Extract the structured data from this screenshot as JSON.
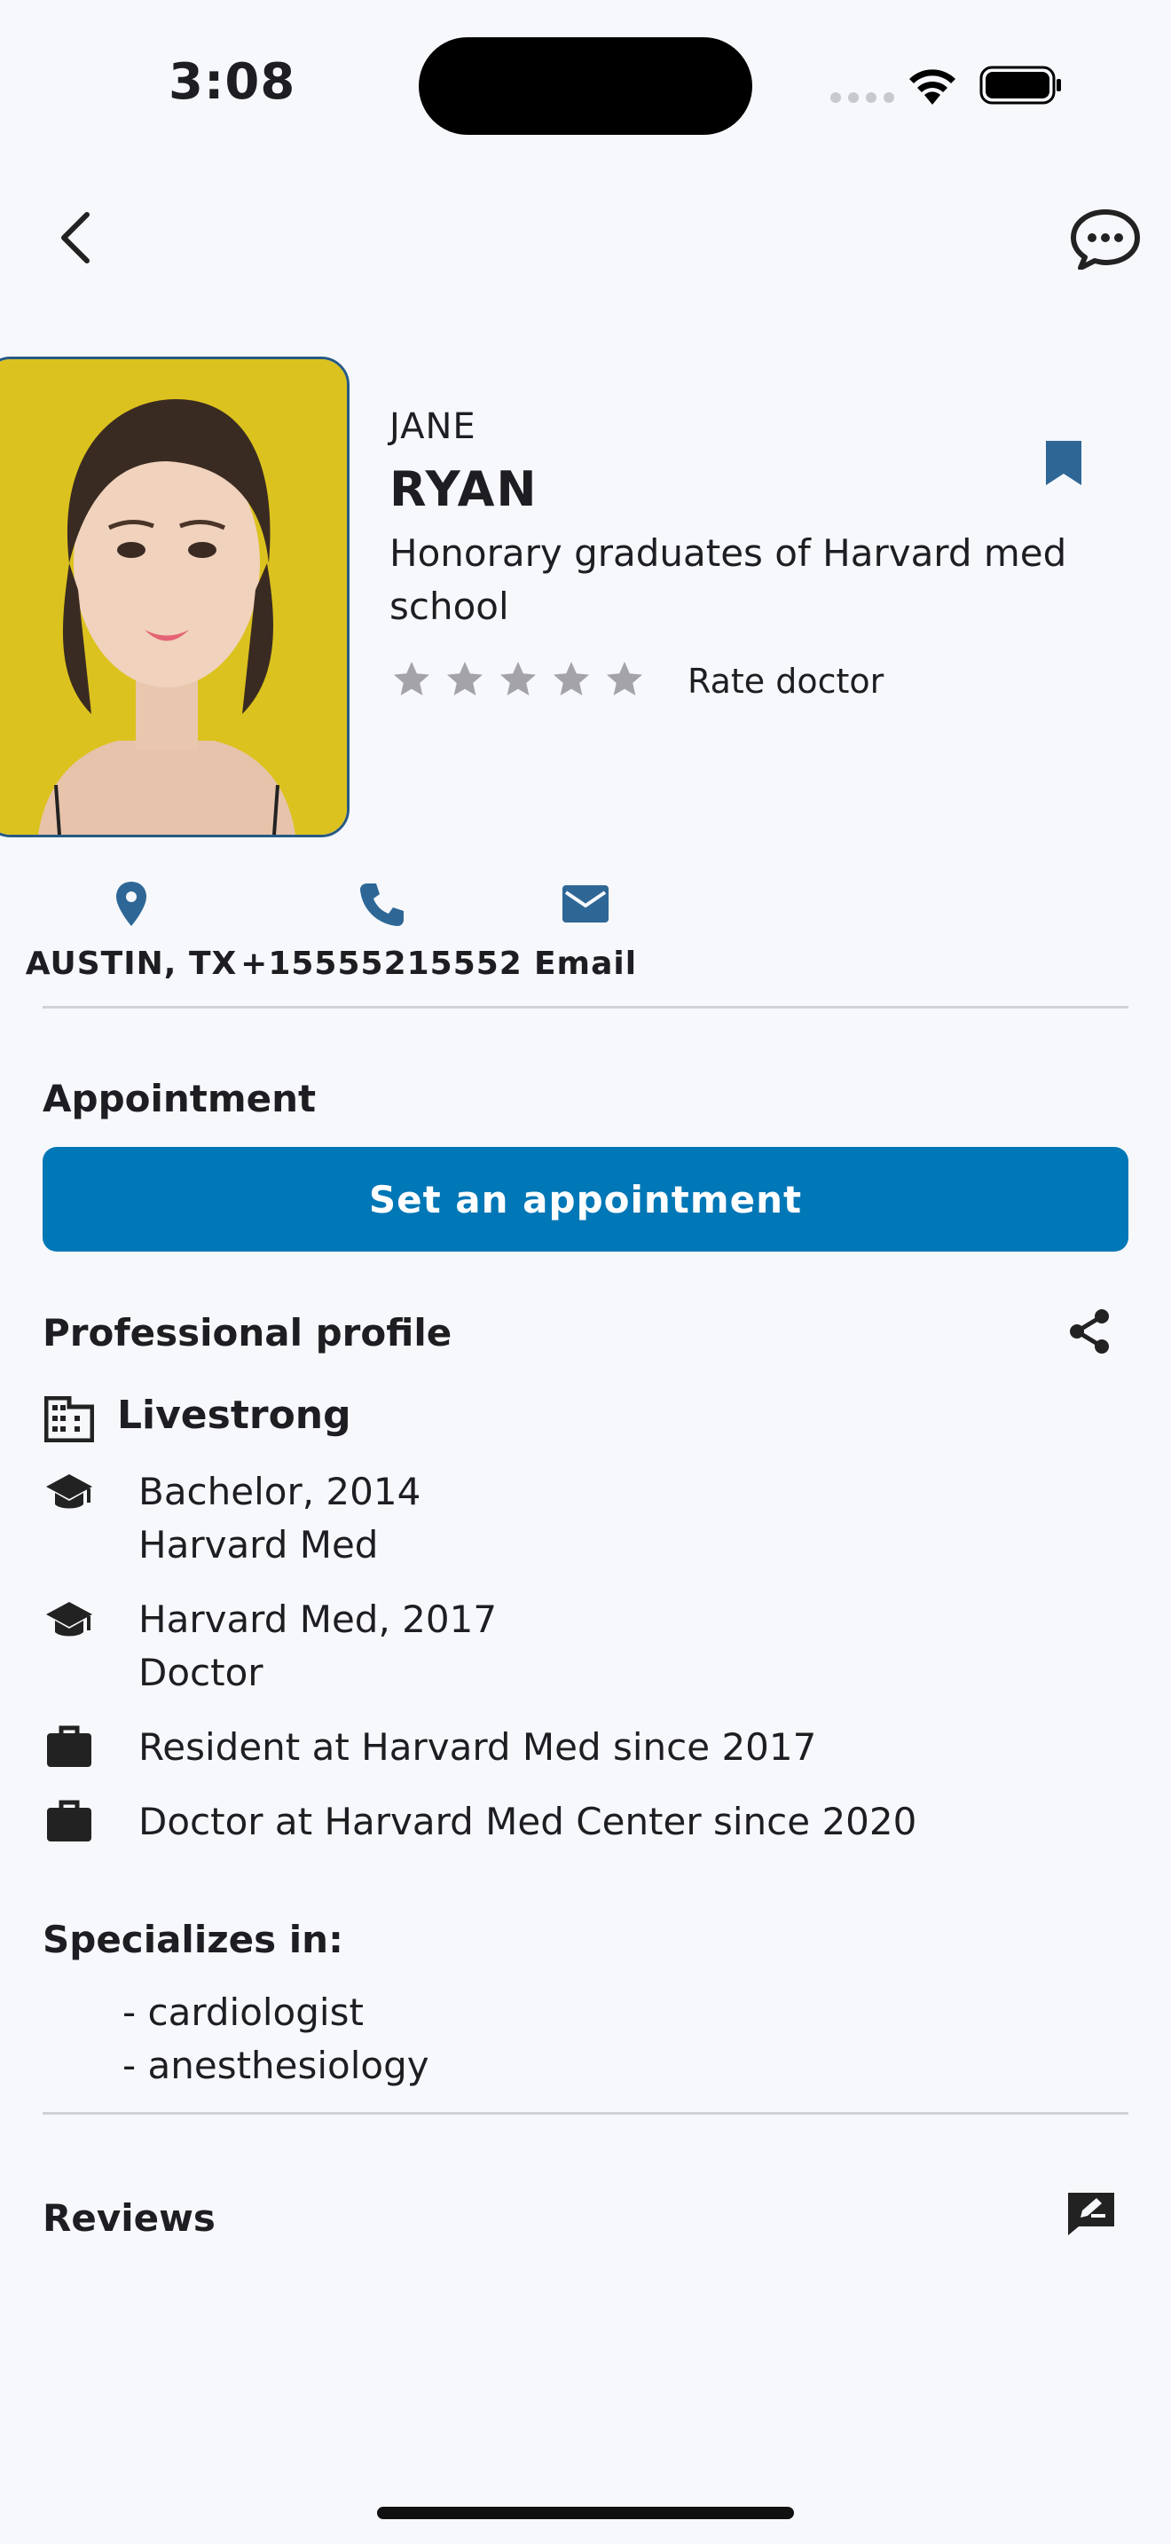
{
  "status_bar": {
    "time": "3:08"
  },
  "profile": {
    "first_name": "JANE",
    "last_name": "RYAN",
    "tagline": "Honorary graduates of Harvard med school",
    "rating_stars": 0,
    "rating_max": 5,
    "rate_label": "Rate doctor"
  },
  "contacts": {
    "location": "AUSTIN, TX",
    "phone": "+15555215552",
    "email": "Email"
  },
  "appointment": {
    "title": "Appointment",
    "button_label": "Set an appointment"
  },
  "professional": {
    "title": "Professional profile",
    "organization": "Livestrong",
    "education": [
      {
        "line1": "Bachelor, 2014",
        "line2": "Harvard Med"
      },
      {
        "line1": "Harvard Med, 2017",
        "line2": "Doctor"
      }
    ],
    "experience": [
      "Resident at Harvard Med since 2017",
      "Doctor at Harvard Med Center since 2020"
    ]
  },
  "specializes": {
    "title": "Specializes in:",
    "items": [
      "- cardiologist",
      "- anesthesiology"
    ]
  },
  "reviews": {
    "title": "Reviews"
  },
  "colors": {
    "accent": "#0077b6",
    "icon_blue": "#2e6796",
    "star_gray": "#a3a3a8",
    "background": "#f6f8fc"
  }
}
